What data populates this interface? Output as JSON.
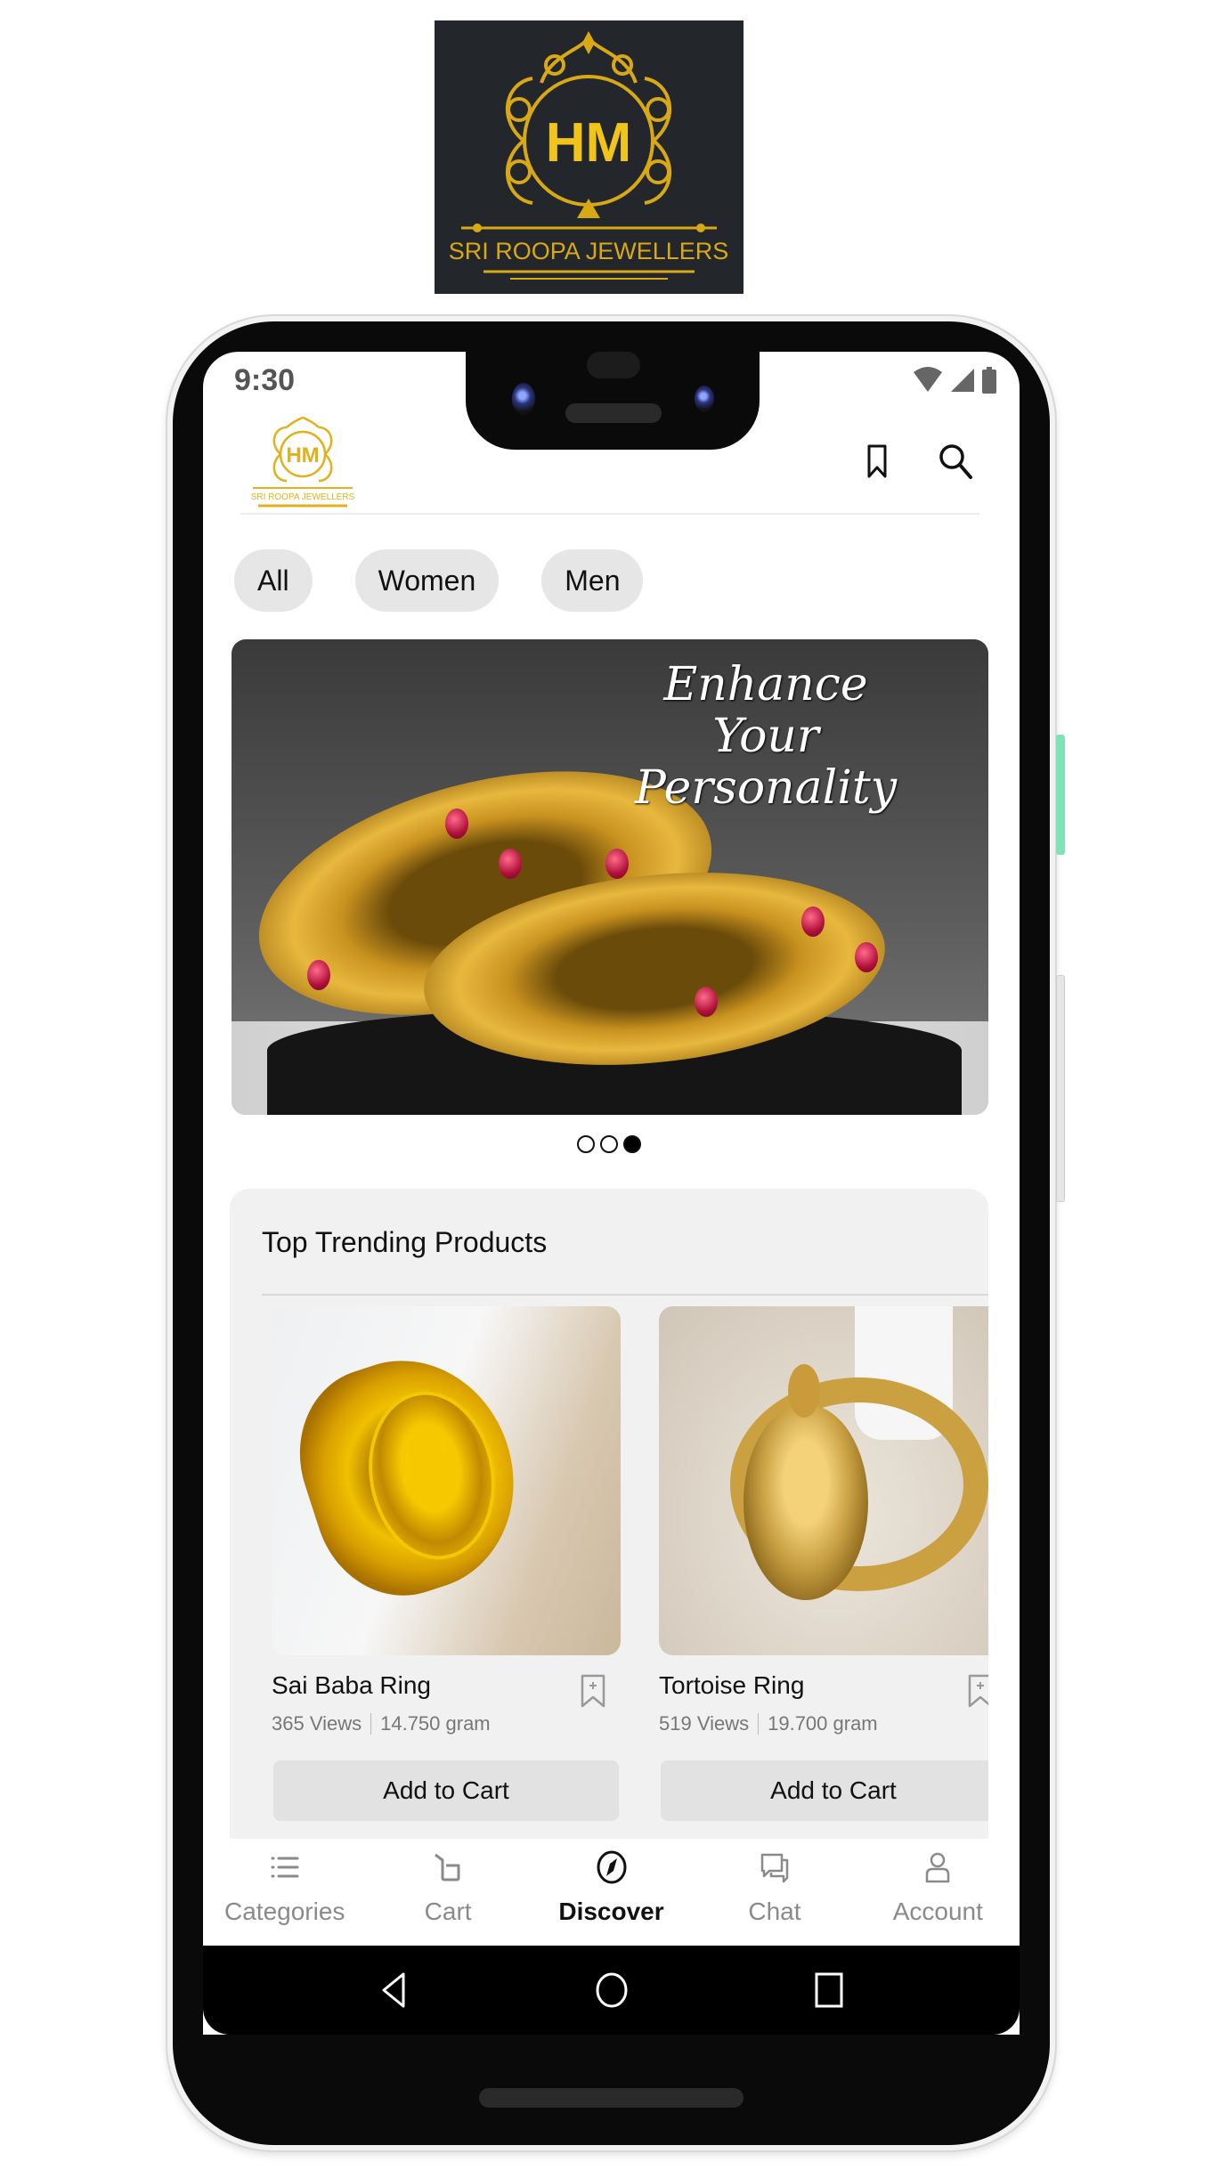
{
  "brand": {
    "monogram": "HM",
    "name": "SRI ROOPA JEWELLERS",
    "gold": "#e0b11c",
    "bg": "#23272b"
  },
  "status_bar": {
    "time": "9:30",
    "icons": [
      "wifi-icon",
      "signal-icon",
      "battery-icon"
    ]
  },
  "header": {
    "logo_monogram": "HM",
    "logo_text": "SRI ROOPA JEWELLERS",
    "actions": [
      "bookmark-icon",
      "search-icon"
    ]
  },
  "filters": {
    "chips": [
      {
        "label": "All"
      },
      {
        "label": "Women"
      },
      {
        "label": "Men"
      }
    ]
  },
  "banner": {
    "line1": "Enhance Your",
    "line2": "Personality",
    "slides": 3,
    "active_slide": 3
  },
  "trending": {
    "title": "Top Trending Products",
    "products": [
      {
        "name": "Sai Baba Ring",
        "views": "365 Views",
        "weight": "14.750 gram",
        "cta": "Add to Cart"
      },
      {
        "name": "Tortoise Ring",
        "views": "519 Views",
        "weight": "19.700 gram",
        "cta": "Add to Cart"
      }
    ]
  },
  "bottom_nav": {
    "items": [
      {
        "label": "Categories",
        "icon": "list-icon"
      },
      {
        "label": "Cart",
        "icon": "cart-icon"
      },
      {
        "label": "Discover",
        "icon": "compass-icon",
        "active": true
      },
      {
        "label": "Chat",
        "icon": "chat-icon"
      },
      {
        "label": "Account",
        "icon": "user-icon"
      }
    ]
  },
  "system_nav": [
    "back-icon",
    "home-icon",
    "recents-icon"
  ]
}
